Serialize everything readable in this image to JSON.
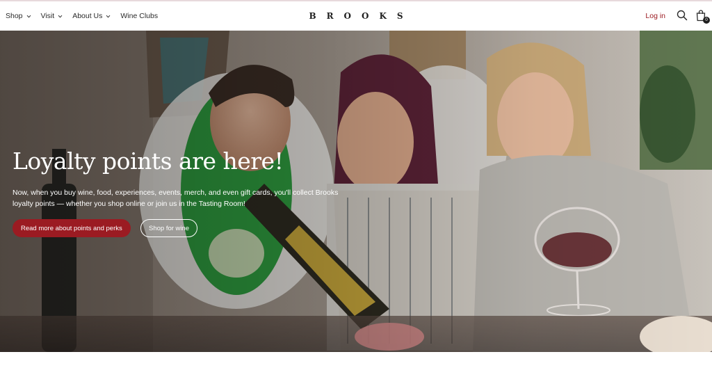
{
  "nav": {
    "items": [
      {
        "label": "Shop",
        "has_dropdown": true
      },
      {
        "label": "Visit",
        "has_dropdown": true
      },
      {
        "label": "About Us",
        "has_dropdown": true
      },
      {
        "label": "Wine Clubs",
        "has_dropdown": false
      }
    ],
    "logo": "BROOKS",
    "login_label": "Log in",
    "search_icon": "search-icon",
    "cart_icon": "shopping-bag-icon",
    "cart_count": "0"
  },
  "hero": {
    "headline": "Loyalty points are here!",
    "subtext": "Now, when you buy wine, food, experiences, events, merch, and even gift cards, you'll collect Brooks loyalty points — whether you shop online or join us in the Tasting Room!",
    "primary_button": "Read more about points and perks",
    "secondary_button": "Shop for wine",
    "image": "three-women-laughing-pouring-wine"
  },
  "colors": {
    "accent": "#9b1b22",
    "text": "#2a2a2a",
    "background": "#ffffff"
  }
}
